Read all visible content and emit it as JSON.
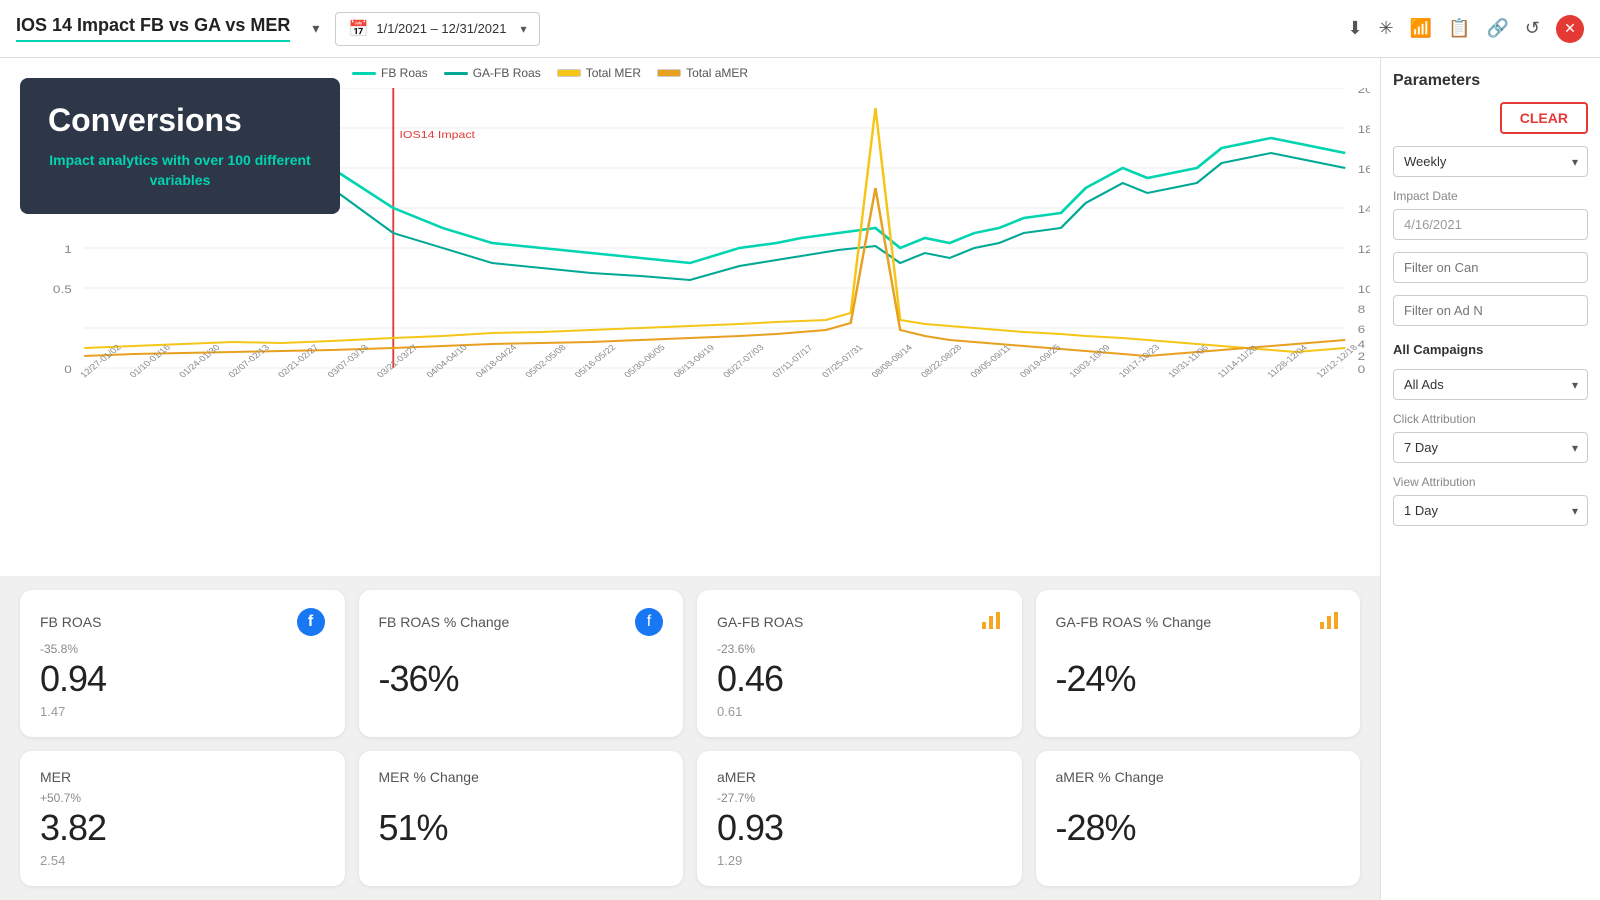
{
  "header": {
    "title": "IOS 14 Impact FB vs GA vs MER",
    "date_range": "1/1/2021 – 12/31/2021",
    "icons": [
      "download-icon",
      "brightness-icon",
      "bar-chart-icon",
      "copy-icon",
      "link-icon",
      "refresh-icon",
      "close-icon"
    ]
  },
  "chart": {
    "legend": [
      {
        "label": "FB Roas",
        "color": "#00d4b1"
      },
      {
        "label": "GA-FB Roas",
        "color": "#00a896"
      },
      {
        "label": "Total MER",
        "color": "#f5c518"
      },
      {
        "label": "Total aMER",
        "color": "#e8a020"
      }
    ],
    "impact_label": "IOS14 Impact",
    "y_left_max": 2.5,
    "y_right_max": 20
  },
  "conversions": {
    "title": "Conversions",
    "subtitle": "Impact analytics with over 100 different variables"
  },
  "metrics": [
    {
      "title": "FB ROAS",
      "icon": "fb-icon",
      "icon_char": "f",
      "change": "-35.8%",
      "value": "0.94",
      "prev": "1.47"
    },
    {
      "title": "FB ROAS % Change",
      "icon": "fb-icon2",
      "icon_char": "f",
      "change": "",
      "value": "-36%",
      "prev": ""
    },
    {
      "title": "GA-FB ROAS",
      "icon": "bar-icon",
      "icon_char": "📊",
      "change": "-23.6%",
      "value": "0.46",
      "prev": "0.61"
    },
    {
      "title": "GA-FB ROAS % Change",
      "icon": "bar-icon2",
      "icon_char": "📊",
      "change": "",
      "value": "-24%",
      "prev": ""
    },
    {
      "title": "MER",
      "icon": "none",
      "icon_char": "",
      "change": "+50.7%",
      "value": "3.82",
      "prev": "2.54"
    },
    {
      "title": "MER % Change",
      "icon": "none",
      "icon_char": "",
      "change": "",
      "value": "51%",
      "prev": ""
    },
    {
      "title": "aMER",
      "icon": "none",
      "icon_char": "",
      "change": "-27.7%",
      "value": "0.93",
      "prev": "1.29"
    },
    {
      "title": "aMER % Change",
      "icon": "none",
      "icon_char": "",
      "change": "",
      "value": "-28%",
      "prev": ""
    }
  ],
  "params": {
    "title": "Parameters",
    "clear_label": "CLEAR",
    "frequency_label": "Weekly",
    "impact_date_label": "Impact Date",
    "impact_date_value": "4/16/2021",
    "filter_campaign_placeholder": "Filter on Can",
    "filter_ad_placeholder": "Filter on Ad N",
    "all_campaigns_label": "All Campaigns",
    "all_ads_label": "All Ads",
    "click_attribution_label": "Click Attribution",
    "click_attribution_value": "7 Day",
    "view_attribution_label": "View Attribution",
    "view_attribution_value": "1 Day"
  }
}
